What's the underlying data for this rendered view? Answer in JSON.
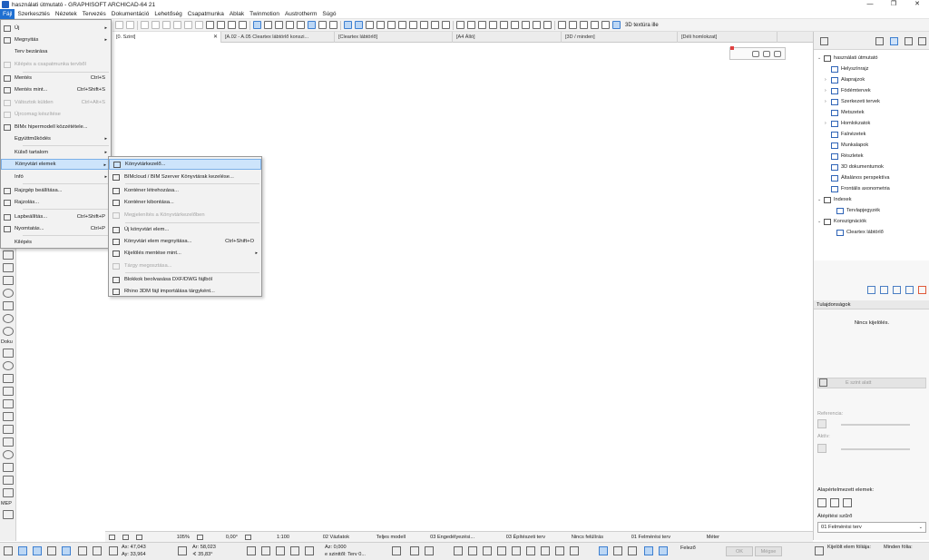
{
  "window": {
    "title": "használati útmutató - GRAPHISOFT ARCHICAD-64 21",
    "controls": [
      "—",
      "❐",
      "✕"
    ]
  },
  "menubar": [
    "Fájl",
    "Szerkesztés",
    "Nézetek",
    "Tervezés",
    "Dokumentáció",
    "Lehetőség",
    "Csapatmunka",
    "Ablak",
    "Twinmotion",
    "Austrotherm",
    "Súgó"
  ],
  "toolbar": {
    "texture_label": "3D textúra ille"
  },
  "tabs": [
    {
      "label": "[0. Szint]",
      "close": "✕"
    },
    {
      "label": "[A.02 - A.05 Cleartex lábtörlő konszi...",
      "close": ""
    },
    {
      "label": "[Cleartex lábtörlő]",
      "close": ""
    },
    {
      "label": "[A4 Álló]",
      "close": ""
    },
    {
      "label": "[3D / minden]",
      "close": ""
    },
    {
      "label": "[Déli homlokzat]",
      "close": ""
    }
  ],
  "file_menu": [
    {
      "label": "Új",
      "shortcut": "",
      "arrow": "▸",
      "state": "normal"
    },
    {
      "label": "Megnyitás",
      "shortcut": "",
      "arrow": "▸",
      "state": "normal"
    },
    {
      "label": "Terv bezárása",
      "shortcut": "",
      "arrow": "",
      "state": "normal"
    },
    {
      "label": "Kilépés a csapatmunka tervből",
      "shortcut": "",
      "arrow": "",
      "state": "disabled"
    },
    {
      "label": "Mentés",
      "shortcut": "Ctrl+S",
      "arrow": "",
      "state": "normal"
    },
    {
      "label": "Mentés mint...",
      "shortcut": "Ctrl+Shift+S",
      "arrow": "",
      "state": "normal"
    },
    {
      "label": "Változtok külden",
      "shortcut": "Ctrl+Alt+S",
      "arrow": "",
      "state": "disabled"
    },
    {
      "label": "Újrcomag készítése",
      "shortcut": "",
      "arrow": "",
      "state": "disabled"
    },
    {
      "label": "BIMx hipermodell közzététele...",
      "shortcut": "",
      "arrow": "",
      "state": "normal"
    },
    {
      "label": "Együttműködés",
      "shortcut": "",
      "arrow": "▸",
      "state": "normal"
    },
    {
      "label": "Külső tartalom",
      "shortcut": "",
      "arrow": "▸",
      "state": "normal"
    },
    {
      "label": "Könyvtári elemek",
      "shortcut": "",
      "arrow": "▸",
      "state": "highlighted"
    },
    {
      "label": "Infó",
      "shortcut": "",
      "arrow": "▸",
      "state": "normal"
    },
    {
      "label": "Rajzgép beállítása...",
      "shortcut": "",
      "arrow": "",
      "state": "normal"
    },
    {
      "label": "Rajzolás...",
      "shortcut": "",
      "arrow": "",
      "state": "normal"
    },
    {
      "label": "Lapbeállítás...",
      "shortcut": "Ctrl+Shift+P",
      "arrow": "",
      "state": "normal"
    },
    {
      "label": "Nyomtatás...",
      "shortcut": "Ctrl+P",
      "arrow": "",
      "state": "normal"
    },
    {
      "label": "Kilépés",
      "shortcut": "",
      "arrow": "",
      "state": "normal"
    }
  ],
  "library_submenu": [
    {
      "label": "Könyvtárkezelő...",
      "shortcut": "",
      "arrow": "",
      "state": "highlighted"
    },
    {
      "label": "BIMcloud / BIM Szerver Könyvtárak kezelése...",
      "shortcut": "",
      "arrow": "",
      "state": "normal"
    },
    {
      "label": "Konténer létrehozása...",
      "shortcut": "",
      "arrow": "",
      "state": "normal"
    },
    {
      "label": "Konténer kibontása...",
      "shortcut": "",
      "arrow": "",
      "state": "normal"
    },
    {
      "label": "Megjelenítés a Könyvtárkezelőben",
      "shortcut": "",
      "arrow": "",
      "state": "disabled"
    },
    {
      "label": "Új könyvtári elem...",
      "shortcut": "",
      "arrow": "",
      "state": "normal"
    },
    {
      "label": "Könyvtári elem megnyitása...",
      "shortcut": "Ctrl+Shift+O",
      "arrow": "",
      "state": "normal"
    },
    {
      "label": "Kijelölés mentése mint...",
      "shortcut": "",
      "arrow": "▸",
      "state": "normal"
    },
    {
      "label": "Tárgy megosztása...",
      "shortcut": "",
      "arrow": "",
      "state": "disabled"
    },
    {
      "label": "Blokkok beolvasása DXF/DWG fájlból",
      "shortcut": "",
      "arrow": "",
      "state": "normal"
    },
    {
      "label": "Rhino 3DM fájl importálása tárgyként...",
      "shortcut": "",
      "arrow": "",
      "state": "normal"
    }
  ],
  "toolbox_labels": {
    "doc": "Doku",
    "mep": "MEP"
  },
  "navigator": {
    "root": "használati útmutató",
    "items": [
      {
        "label": "Helyszínrajz",
        "expand": ""
      },
      {
        "label": "Alaprajzok",
        "expand": "›"
      },
      {
        "label": "Födémtervek",
        "expand": "›"
      },
      {
        "label": "Szerkezeti tervek",
        "expand": "›"
      },
      {
        "label": "Metszetek",
        "expand": ""
      },
      {
        "label": "Homlokzatok",
        "expand": "›"
      },
      {
        "label": "Falnézetek",
        "expand": ""
      },
      {
        "label": "Munkalapok",
        "expand": ""
      },
      {
        "label": "Részletek",
        "expand": ""
      },
      {
        "label": "3D dokumentumok",
        "expand": ""
      },
      {
        "label": "Általános perspektíva",
        "expand": ""
      },
      {
        "label": "Frontális axonometria",
        "expand": ""
      },
      {
        "label": "Indexek",
        "expand": "⌄"
      },
      {
        "label": "Tervlapjegyzék",
        "expand": ""
      },
      {
        "label": "Konszignációk",
        "expand": "⌄"
      },
      {
        "label": "Cleartex lábtörlő",
        "expand": ""
      }
    ]
  },
  "properties": {
    "header": "Tulajdonságok",
    "no_selection": "Nincs kijelölés.",
    "story": "E szint alatt",
    "reference_label": "Referencia:",
    "active_label": "Aktív:",
    "defaults_label": "Alapértelmezett elemek:",
    "filter_label": "Átépítési szűrő",
    "filter_value": "01 Felmérési terv"
  },
  "nav_status": {
    "zoom": "105%",
    "angle": "0,00°",
    "scale": "1:100",
    "layer_combo": "02 Vázlatok",
    "model_view": "Teljes modell",
    "pen_set": "03 Engedélyezési...",
    "dimension": "03 Építészeti terv",
    "override": "Nincs felülírás",
    "renovation": "01 Felmérési terv",
    "unit": "Méter"
  },
  "bottom_bar": {
    "ax": "Ax: 47,043",
    "ay": "Ay: 33,964",
    "ar": "Ar: 58,023",
    "aangle": "∢ 35,83°",
    "az": "Az: 0,000",
    "zref": "e szinttől: Terv 0...",
    "ghost": "Felező",
    "ok": "OK",
    "cancel": "Mégse",
    "selected_lbl": "Kijelölt elem fóliája:",
    "all_lbl": "Minden fólia:"
  }
}
